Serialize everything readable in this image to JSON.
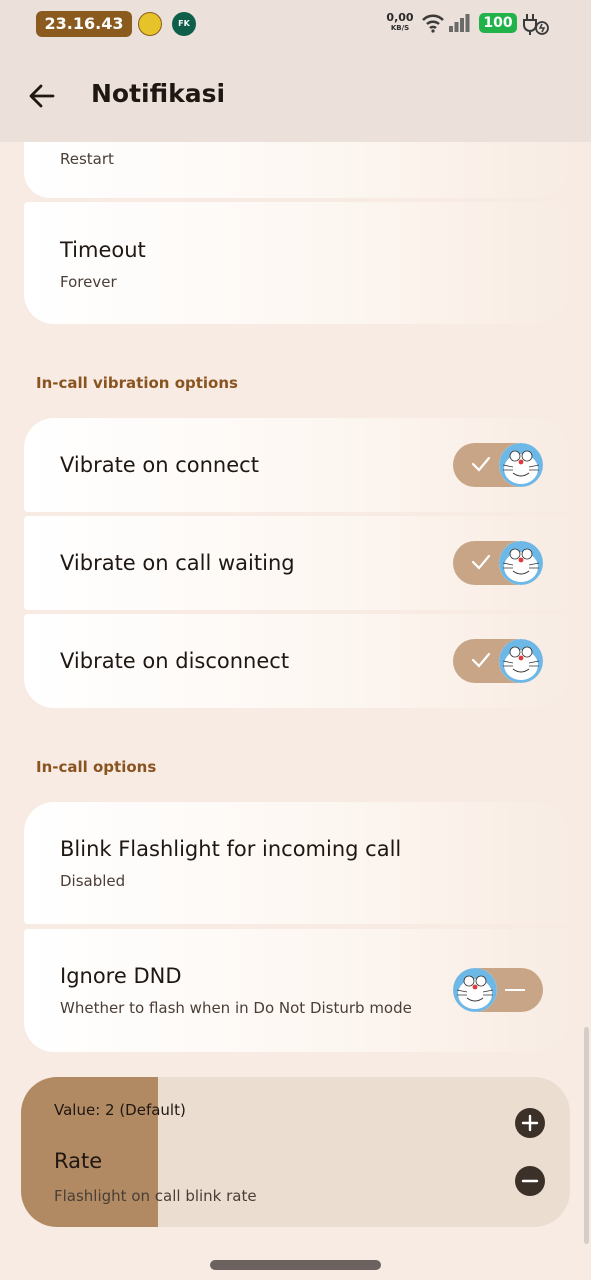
{
  "status_bar": {
    "time": "23.16.43",
    "app_icon_2_text": "FK",
    "net_speed": "0,00",
    "net_unit": "KB/S",
    "battery": "100"
  },
  "header": {
    "title": "Notifikasi",
    "back_icon": "arrow-left-icon"
  },
  "items": {
    "restart_partial_sub": "Restart",
    "timeout": {
      "title": "Timeout",
      "subtitle": "Forever"
    }
  },
  "section_vibration": {
    "header": "In-call vibration options",
    "items": [
      {
        "label": "Vibrate on connect",
        "toggle": true
      },
      {
        "label": "Vibrate on call waiting",
        "toggle": true
      },
      {
        "label": "Vibrate on disconnect",
        "toggle": true
      }
    ]
  },
  "section_options": {
    "header": "In-call options",
    "blink": {
      "title": "Blink Flashlight for incoming call",
      "subtitle": "Disabled"
    },
    "dnd": {
      "title": "Ignore DND",
      "subtitle": "Whether to flash when in Do Not Disturb mode",
      "toggle": false
    }
  },
  "rate_dialog": {
    "value": "Value: 2 (Default)",
    "title": "Rate",
    "subtitle": "Flashlight on call blink rate",
    "fill_fraction": 0.25,
    "increase_icon": "plus-icon",
    "decrease_icon": "minus-icon"
  },
  "colors": {
    "accent": "#8a5420",
    "toggle_track": "#c7a586",
    "battery": "#21b34a"
  }
}
